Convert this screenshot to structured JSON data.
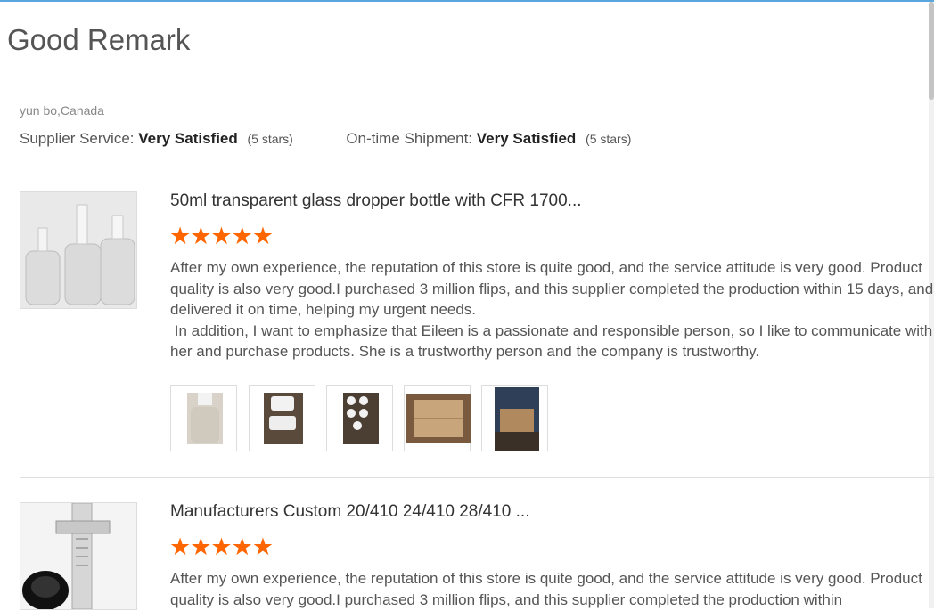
{
  "page": {
    "title": "Good Remark"
  },
  "review_header": {
    "reviewer": "yun bo,Canada",
    "supplier_service_label": "Supplier Service:",
    "supplier_service_value": "Very Satisfied",
    "supplier_service_count": "(5 stars)",
    "shipment_label": "On-time Shipment:",
    "shipment_value": "Very Satisfied",
    "shipment_count": "(5 stars)"
  },
  "reviews": [
    {
      "product_name": "50ml transparent glass dropper bottle with CFR 1700...",
      "stars": "★★★★★",
      "rating": 5,
      "text": "After my own experience, the reputation of this store is quite good, and the service attitude is very good. Product quality is also very good.I purchased 3 million flips, and this supplier completed the production within 15 days, and delivered it on time, helping my urgent needs.\n In addition, I want to emphasize that Eileen is a passionate and responsible person, so I like to communicate with her and purchase products. She is a trustworthy person and the company is trustworthy."
    },
    {
      "product_name": "Manufacturers Custom 20/410 24/410 28/410 ...",
      "stars": "★★★★★",
      "rating": 5,
      "text": "After my own experience, the reputation of this store is quite good, and the service attitude is very good. Product quality is also very good.I purchased 3 million flips, and this supplier completed the production within"
    }
  ],
  "colors": {
    "star": "#ff6600",
    "accent_line": "#5aa7e0"
  }
}
